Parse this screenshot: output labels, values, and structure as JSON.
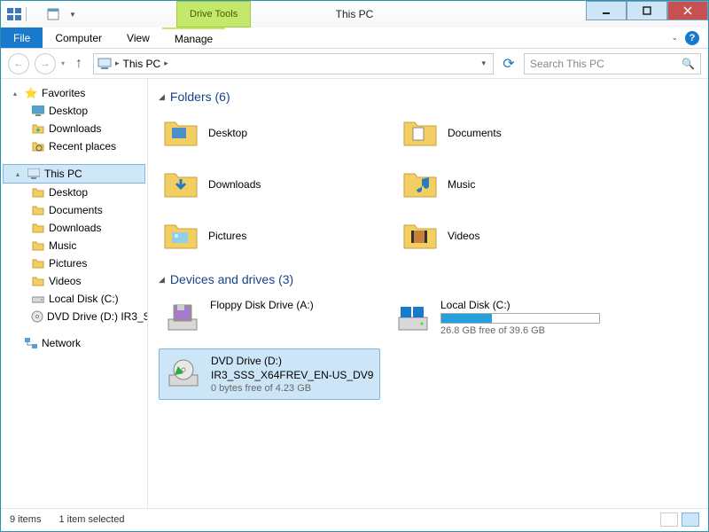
{
  "window": {
    "title": "This PC",
    "context_tab": "Drive Tools"
  },
  "menu": {
    "file": "File",
    "computer": "Computer",
    "view": "View",
    "manage": "Manage"
  },
  "breadcrumb": {
    "location": "This PC"
  },
  "search": {
    "placeholder": "Search This PC"
  },
  "nav": {
    "favorites": {
      "label": "Favorites",
      "items": [
        "Desktop",
        "Downloads",
        "Recent places"
      ]
    },
    "thispc": {
      "label": "This PC",
      "items": [
        "Desktop",
        "Documents",
        "Downloads",
        "Music",
        "Pictures",
        "Videos",
        "Local Disk (C:)",
        "DVD Drive (D:) IR3_S"
      ]
    },
    "network": {
      "label": "Network"
    }
  },
  "groups": {
    "folders": {
      "label": "Folders (6)",
      "items": [
        "Desktop",
        "Documents",
        "Downloads",
        "Music",
        "Pictures",
        "Videos"
      ]
    },
    "drives": {
      "label": "Devices and drives (3)",
      "items": [
        {
          "name": "Floppy Disk Drive (A:)",
          "sub": "",
          "bar": null
        },
        {
          "name": "Local Disk (C:)",
          "sub": "26.8 GB free of 39.6 GB",
          "bar_pct": 32
        },
        {
          "name": "DVD Drive (D:)",
          "name2": "IR3_SSS_X64FREV_EN-US_DV9",
          "sub": "0 bytes free of 4.23 GB",
          "selected": true
        }
      ]
    }
  },
  "status": {
    "count": "9 items",
    "selection": "1 item selected"
  }
}
